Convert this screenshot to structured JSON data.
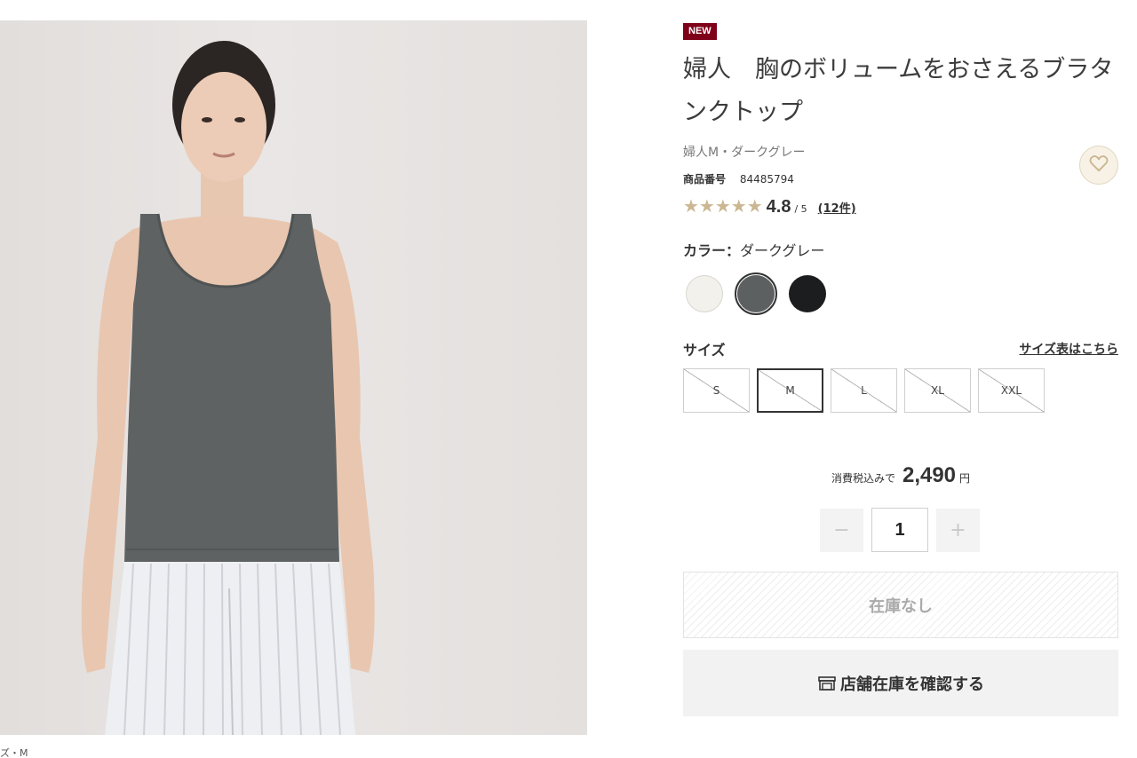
{
  "product": {
    "badge": "NEW",
    "title": "婦人　胸のボリュームをおさえるブラタンクトップ",
    "variant_text": "婦人M・ダークグレー",
    "code_label": "商品番号",
    "code_value": "84485794",
    "rating": {
      "stars": "★★★★★",
      "value": "4.8",
      "max": "/ 5",
      "count": "(12件)",
      "score": 4.8
    },
    "photo_caption": "ズ・M"
  },
  "colors": {
    "label": "カラー：",
    "selected_name": "ダークグレー",
    "swatches": [
      {
        "name": "オフ白",
        "hex": "#f3f1ec",
        "selected": false
      },
      {
        "name": "ダークグレー",
        "hex": "#5d6060",
        "selected": true
      },
      {
        "name": "黒",
        "hex": "#1c1d1e",
        "selected": false
      }
    ]
  },
  "sizes": {
    "label": "サイズ",
    "chart_link": "サイズ表はこちら",
    "options": [
      "S",
      "M",
      "L",
      "XL",
      "XXL"
    ],
    "selected": "M"
  },
  "price": {
    "prefix": "消費税込みで",
    "value": "2,490",
    "unit": "円"
  },
  "quantity": {
    "value": "1",
    "minus": "−",
    "plus": "+"
  },
  "buttons": {
    "out_of_stock": "在庫なし",
    "check_store": "店舗在庫を確認する"
  },
  "theme": {
    "badge_color": "#7f0019",
    "star_color": "#cbb791",
    "favorite_bg": "#f7f1e6"
  },
  "icons": {
    "favorite": "heart-icon",
    "store": "store-icon"
  }
}
